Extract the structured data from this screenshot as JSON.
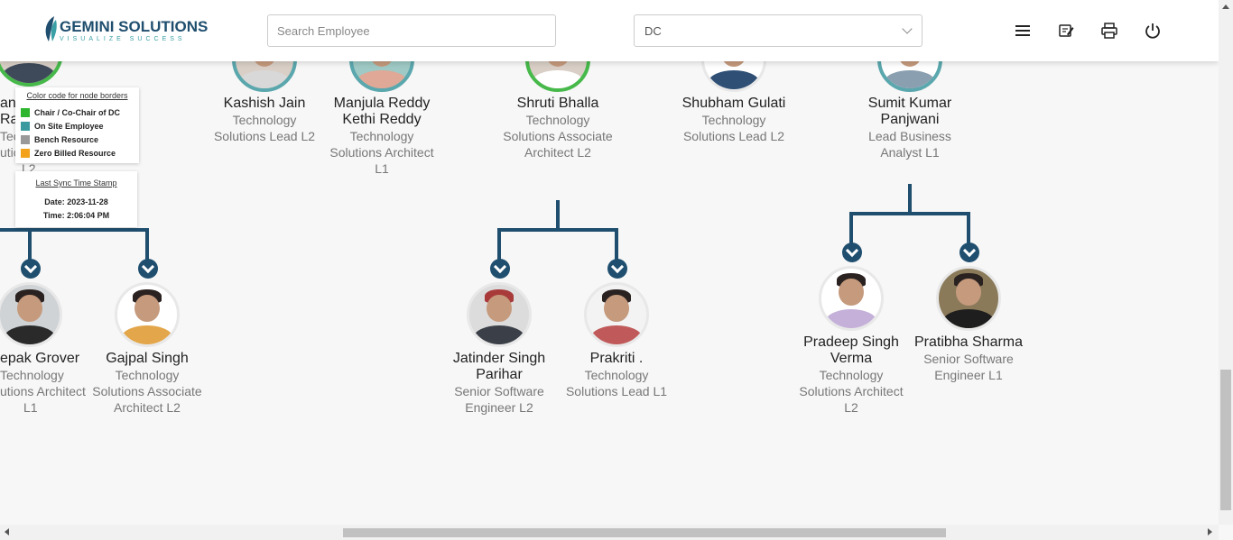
{
  "header": {
    "logo_name": "GEMINI SOLUTIONS",
    "logo_tagline": "VISUALIZE SUCCESS",
    "search_placeholder": "Search Employee",
    "dc_select_value": "DC",
    "icons": [
      "menu-icon",
      "edit-note-icon",
      "print-icon",
      "power-icon"
    ]
  },
  "legend": {
    "title": "Color code for node borders",
    "items": [
      {
        "label": "Chair / Co-Chair of DC",
        "color": "#2db52d"
      },
      {
        "label": "On Site Employee",
        "color": "#3a9aa0"
      },
      {
        "label": "Bench Resource",
        "color": "#999999"
      },
      {
        "label": "Zero Billed Resource",
        "color": "#f2a31b"
      }
    ]
  },
  "sync": {
    "title": "Last Sync Time Stamp",
    "date": "Date: 2023-11-28",
    "time": "Time: 2:06:04 PM"
  },
  "partial_top_left": {
    "name_line1": "an",
    "name_line2": "Rac",
    "title_line1": "Tec",
    "title_line2": "utic",
    "title_line3": "L2"
  },
  "top_row": [
    {
      "name": "Kashish Jain",
      "title": "Technology Solutions Lead L2"
    },
    {
      "name": "Manjula Reddy Kethi Reddy",
      "title": "Technology Solutions Architect L1"
    },
    {
      "name": "Shruti Bhalla",
      "title": "Technology Solutions Associate Architect L2"
    },
    {
      "name": "Shubham Gulati",
      "title": "Technology Solutions Lead L2"
    },
    {
      "name": "Sumit Kumar Panjwani",
      "title": "Lead Business Analyst L1"
    }
  ],
  "bottom_row": [
    {
      "name": "epak Grover",
      "title_line1": "Technology",
      "title_line2": "utions Architect",
      "title_line3": "L1"
    },
    {
      "name": "Gajpal Singh",
      "title": "Technology Solutions Associate Architect L2"
    },
    {
      "name": "Jatinder Singh Parihar",
      "title": "Senior Software Engineer L2"
    },
    {
      "name": "Prakriti .",
      "title": "Technology Solutions Lead L1"
    },
    {
      "name": "Pradeep Singh Verma",
      "title": "Technology Solutions Architect L2"
    },
    {
      "name": "Pratibha Sharma",
      "title": "Senior Software Engineer L1"
    }
  ],
  "colors": {
    "connector": "#1f4e6e",
    "on_site_border": "#5aa7ad",
    "chair_border": "#47b94a"
  }
}
